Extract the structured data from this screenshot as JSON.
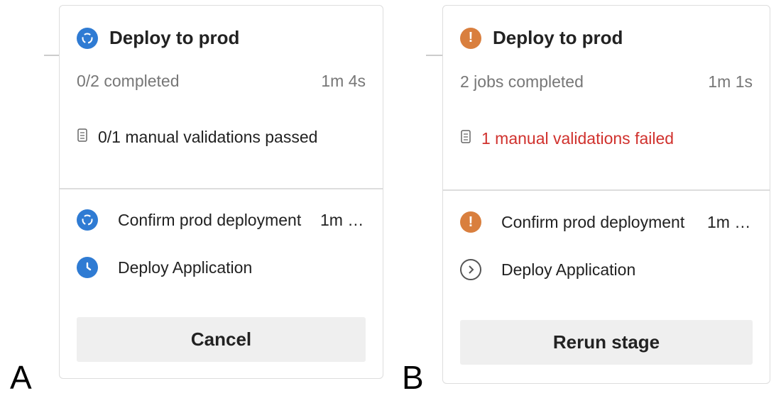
{
  "panels": [
    {
      "letter": "A",
      "title": "Deploy to prod",
      "status": "running",
      "progress": "0/2 completed",
      "duration": "1m 4s",
      "validation": "0/1 manual validations passed",
      "jobs": [
        {
          "name": "Confirm prod deployment",
          "duration": "1m …",
          "status": "running"
        },
        {
          "name": "Deploy Application",
          "duration": "",
          "status": "waiting"
        }
      ],
      "button": "Cancel"
    },
    {
      "letter": "B",
      "title": "Deploy to prod",
      "status": "failed",
      "progress": "2 jobs completed",
      "duration": "1m 1s",
      "validation": "1 manual validations failed",
      "jobs": [
        {
          "name": "Confirm prod deployment",
          "duration": "1m …",
          "status": "failed"
        },
        {
          "name": "Deploy Application",
          "duration": "",
          "status": "skipped"
        }
      ],
      "button": "Rerun stage"
    }
  ],
  "colors": {
    "running": "#2f7bd3",
    "failed": "#d97f3e",
    "error_text": "#d0312d"
  }
}
